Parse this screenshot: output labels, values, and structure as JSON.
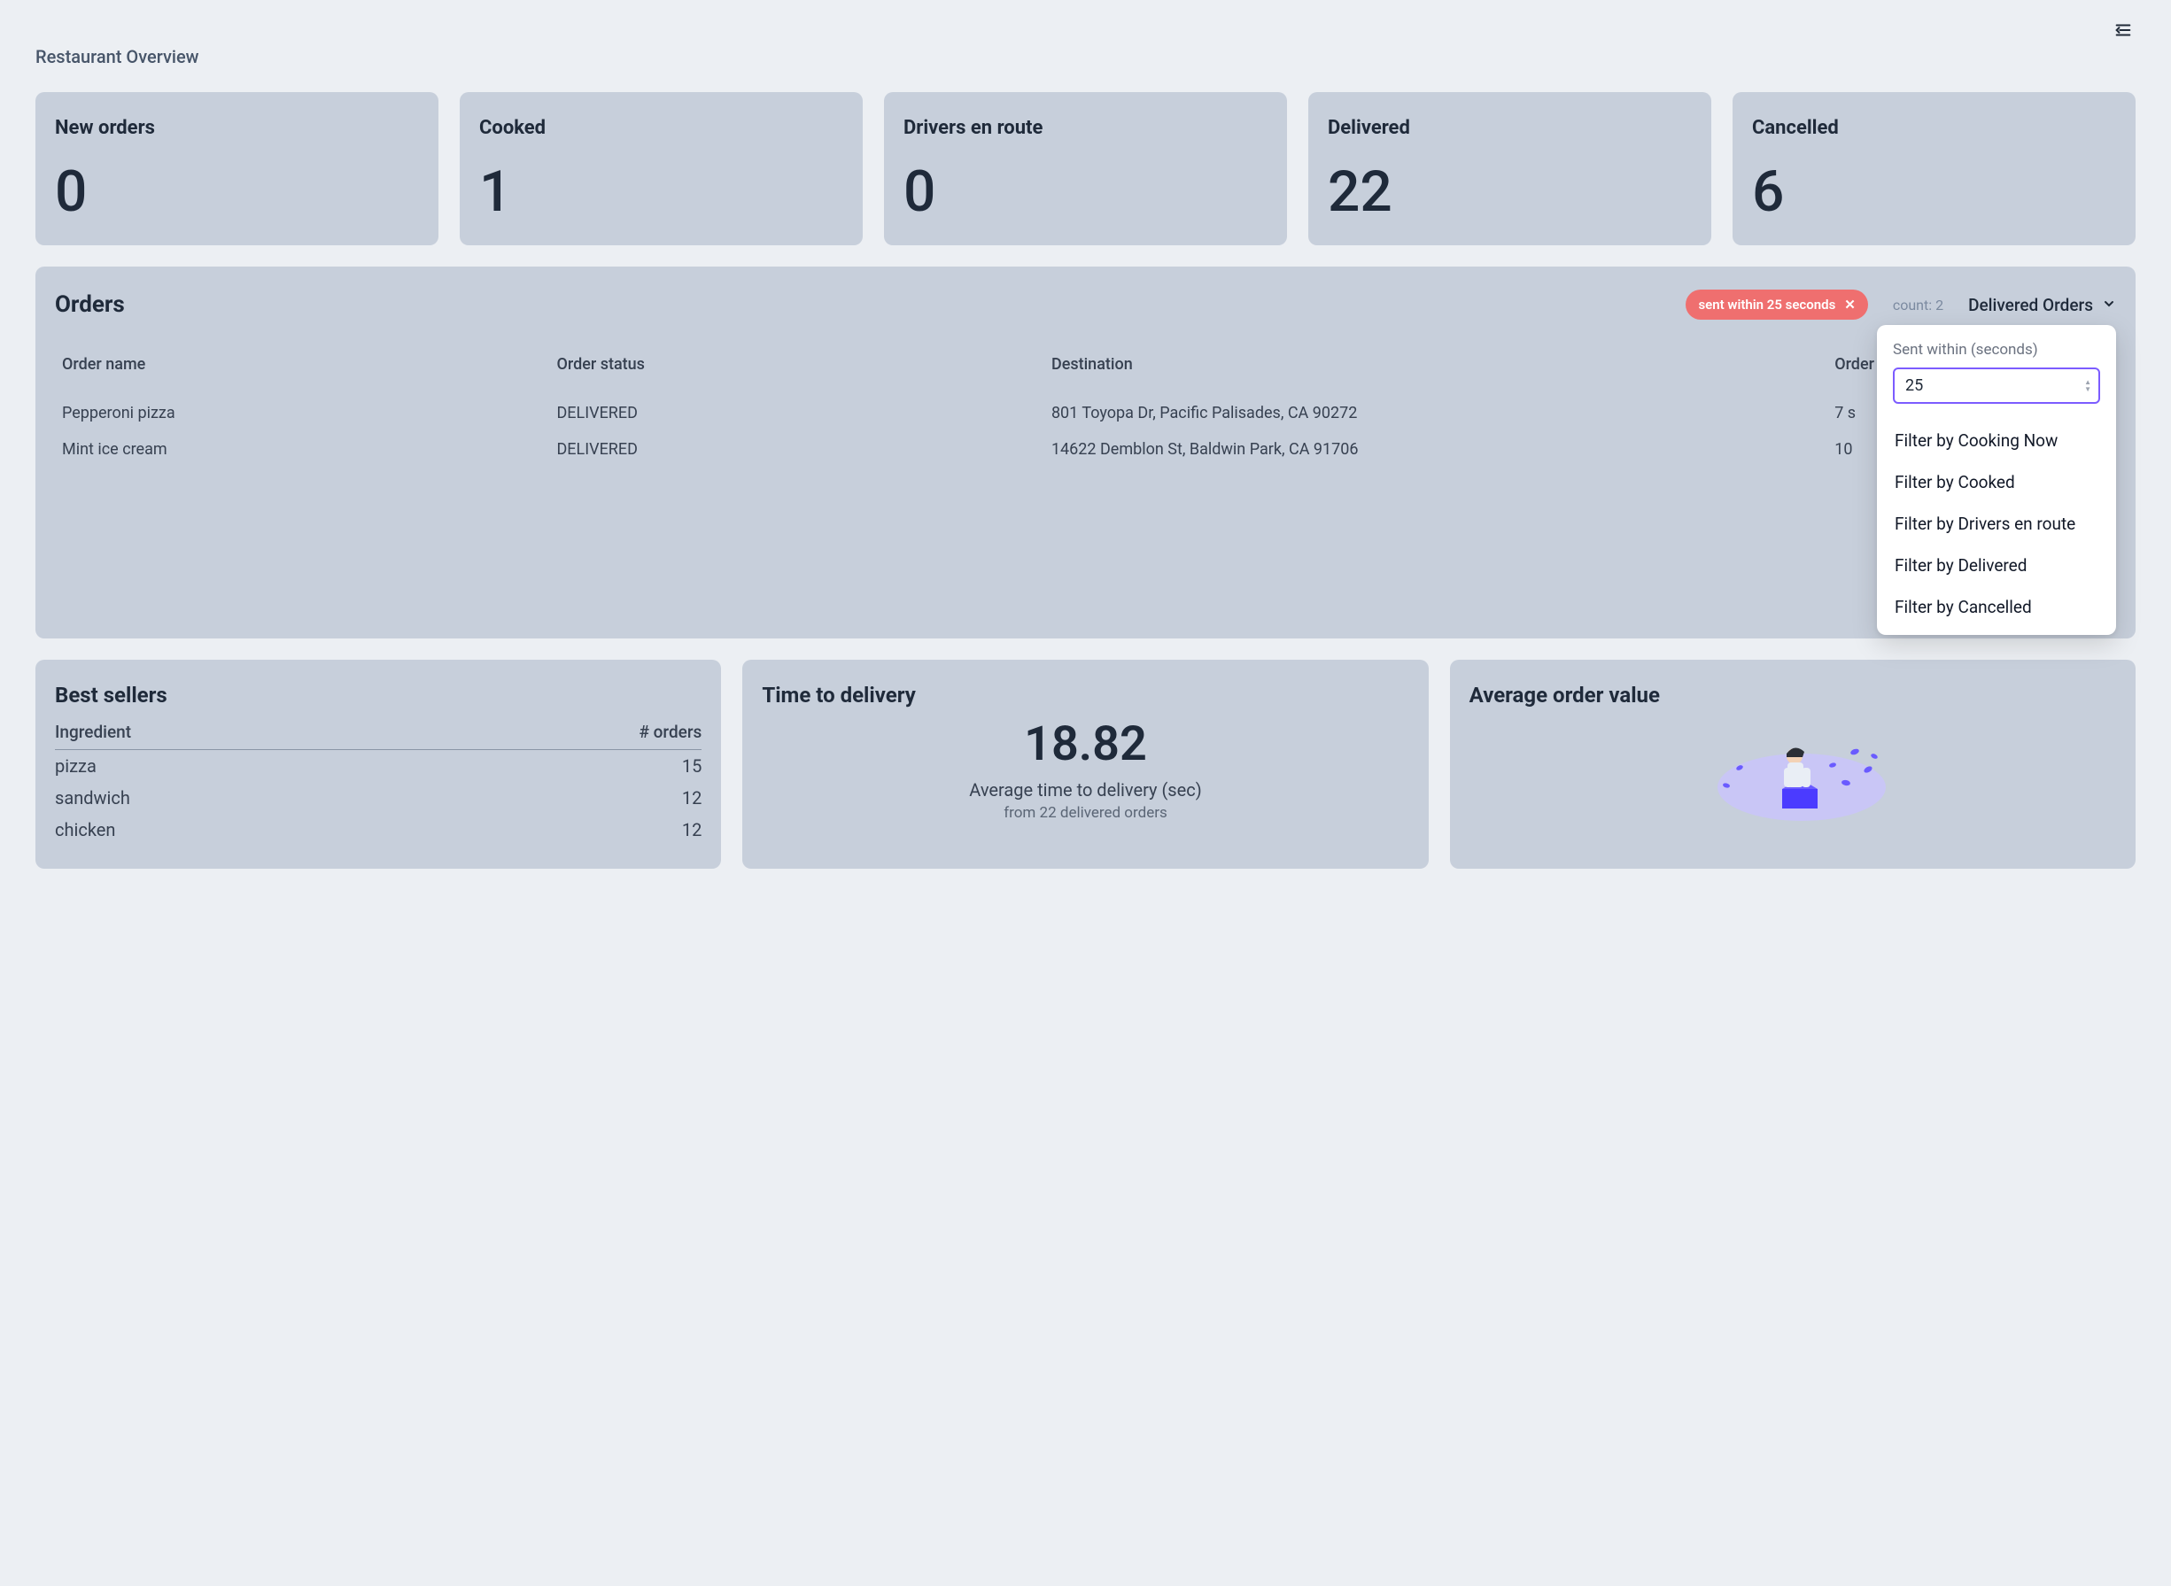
{
  "page_title": "Restaurant Overview",
  "stats": [
    {
      "label": "New orders",
      "value": "0"
    },
    {
      "label": "Cooked",
      "value": "1"
    },
    {
      "label": "Drivers en route",
      "value": "0"
    },
    {
      "label": "Delivered",
      "value": "22"
    },
    {
      "label": "Cancelled",
      "value": "6"
    }
  ],
  "orders": {
    "title": "Orders",
    "chip_label": "sent within 25 seconds",
    "count_label": "count: 2",
    "dropdown_label": "Delivered Orders",
    "columns": {
      "name": "Order name",
      "status": "Order status",
      "destination": "Destination",
      "sent_at": "Order sent"
    },
    "rows": [
      {
        "name": "Pepperoni pizza",
        "status": "DELIVERED",
        "destination": "801 Toyopa Dr, Pacific Palisades, CA 90272",
        "sent_at": "7 s"
      },
      {
        "name": "Mint ice cream",
        "status": "DELIVERED",
        "destination": "14622 Demblon St, Baldwin Park, CA 91706",
        "sent_at": "10"
      }
    ]
  },
  "filter_menu": {
    "field_label": "Sent within (seconds)",
    "field_value": "25",
    "items": [
      "Filter by Cooking Now",
      "Filter by Cooked",
      "Filter by Drivers en route",
      "Filter by Delivered",
      "Filter by Cancelled"
    ]
  },
  "best_sellers": {
    "title": "Best sellers",
    "col_ingredient": "Ingredient",
    "col_orders": "# orders",
    "rows": [
      {
        "ingredient": "pizza",
        "orders": "15"
      },
      {
        "ingredient": "sandwich",
        "orders": "12"
      },
      {
        "ingredient": "chicken",
        "orders": "12"
      }
    ]
  },
  "ttd": {
    "title": "Time to delivery",
    "value": "18.82",
    "label": "Average time to delivery (sec)",
    "sub": "from 22 delivered orders"
  },
  "aov": {
    "title": "Average order value"
  }
}
